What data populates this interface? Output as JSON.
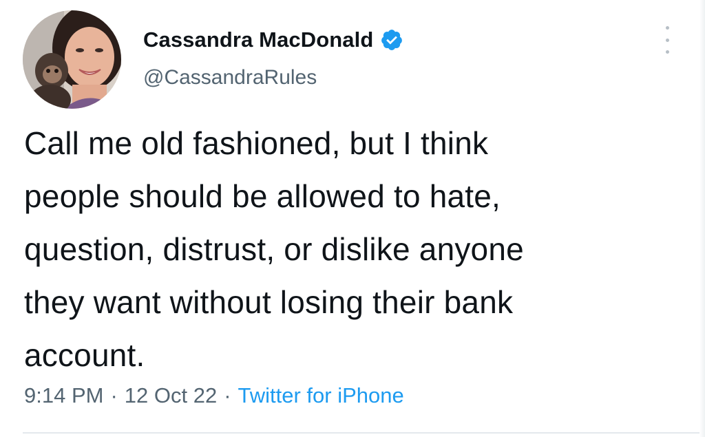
{
  "tweet": {
    "author": {
      "display_name": "Cassandra MacDonald",
      "handle": "@CassandraRules",
      "verified": true,
      "avatar_icon": "profile-photo"
    },
    "text_lines": [
      "Call me old fashioned, but I think",
      "people should be allowed to hate,",
      "question, distrust, or dislike anyone",
      "they want without losing their bank",
      "account."
    ],
    "time": "9:14 PM",
    "separator": "·",
    "date": "12 Oct 22",
    "source": "Twitter for iPhone",
    "more_icon": "more-vertical-icon"
  },
  "colors": {
    "text_primary": "#0f1419",
    "text_secondary": "#536471",
    "link_blue": "#1d9bf0",
    "verified_blue": "#1d9bf0"
  }
}
